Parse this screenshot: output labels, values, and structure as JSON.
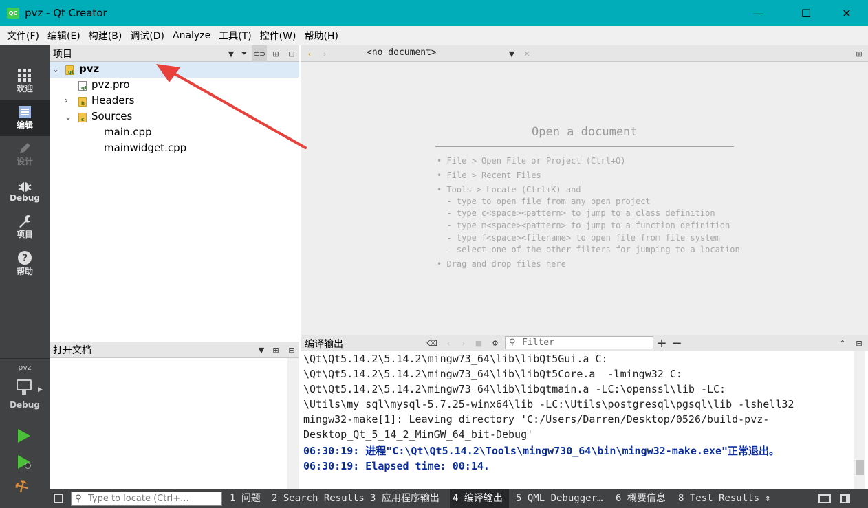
{
  "window": {
    "title": "pvz - Qt Creator",
    "logo": "QC",
    "minimize": "—",
    "maximize": "☐",
    "close": "✕"
  },
  "menu": [
    "文件(F)",
    "编辑(E)",
    "构建(B)",
    "调试(D)",
    "Analyze",
    "工具(T)",
    "控件(W)",
    "帮助(H)"
  ],
  "modes": [
    {
      "label": "欢迎",
      "icon": "grid-icon"
    },
    {
      "label": "编辑",
      "icon": "edit-document-icon"
    },
    {
      "label": "设计",
      "icon": "pencil-icon"
    },
    {
      "label": "Debug",
      "icon": "bug-icon"
    },
    {
      "label": "项目",
      "icon": "wrench-icon"
    },
    {
      "label": "帮助",
      "icon": "help-icon"
    }
  ],
  "kit": {
    "project": "pvz",
    "build": "Debug"
  },
  "project_panel": {
    "title": "项目",
    "tree": [
      {
        "label": "pvz",
        "level": 0,
        "expanded": true,
        "type": "project"
      },
      {
        "label": "pvz.pro",
        "level": 1,
        "type": "pro-file"
      },
      {
        "label": "Headers",
        "level": 1,
        "expanded": false,
        "type": "folder"
      },
      {
        "label": "Sources",
        "level": 1,
        "expanded": true,
        "type": "folder"
      },
      {
        "label": "main.cpp",
        "level": 2,
        "type": "cpp-file"
      },
      {
        "label": "mainwidget.cpp",
        "level": 2,
        "type": "cpp-file"
      }
    ]
  },
  "open_documents": {
    "title": "打开文档"
  },
  "editor": {
    "document_combo": "<no document>",
    "welcome_title": "Open a document",
    "lines": [
      "• File > Open File or Project (Ctrl+O)",
      "• File > Recent Files",
      "• Tools > Locate (Ctrl+K) and",
      "  - type to open file from any open project",
      "  - type c<space><pattern> to jump to a class definition",
      "  - type m<space><pattern> to jump to a function definition",
      "  - type f<space><filename> to open file from file system",
      "  - select one of the other filters for jumping to a location",
      "• Drag and drop files here"
    ]
  },
  "output": {
    "title": "编译输出",
    "filter_placeholder": "Filter",
    "plus": "+",
    "minus": "−",
    "lines": [
      {
        "text": "\\Qt\\Qt5.14.2\\5.14.2\\mingw73_64\\lib\\libQt5Gui.a C:",
        "style": "normal"
      },
      {
        "text": "\\Qt\\Qt5.14.2\\5.14.2\\mingw73_64\\lib\\libQt5Core.a  -lmingw32 C:",
        "style": "normal"
      },
      {
        "text": "\\Qt\\Qt5.14.2\\5.14.2\\mingw73_64\\lib\\libqtmain.a -LC:\\openssl\\lib -LC:",
        "style": "normal"
      },
      {
        "text": "\\Utils\\my_sql\\mysql-5.7.25-winx64\\lib -LC:\\Utils\\postgresql\\pgsql\\lib -lshell32",
        "style": "normal"
      },
      {
        "text": "mingw32-make[1]: Leaving directory 'C:/Users/Darren/Desktop/0526/build-pvz-",
        "style": "normal"
      },
      {
        "text": "Desktop_Qt_5_14_2_MinGW_64_bit-Debug'",
        "style": "normal"
      },
      {
        "text": "06:30:19: 进程\"C:\\Qt\\Qt5.14.2\\Tools\\mingw730_64\\bin\\mingw32-make.exe\"正常退出。",
        "style": "blue"
      },
      {
        "text": "06:30:19: Elapsed time: 00:14.",
        "style": "blue"
      }
    ]
  },
  "statusbar": {
    "locator_placeholder": "Type to locate (Ctrl+...",
    "tabs": [
      {
        "label": "1 问题",
        "active": false
      },
      {
        "label": "2 Search Results",
        "active": false
      },
      {
        "label": "3 应用程序输出",
        "active": false
      },
      {
        "label": "4 编译输出",
        "active": true
      },
      {
        "label": "5 QML Debugger…",
        "active": false
      },
      {
        "label": "6 概要信息",
        "active": false
      },
      {
        "label": "8 Test Results",
        "active": false
      }
    ]
  },
  "colors": {
    "titlebar": "#00adb8",
    "sidebar": "#404244",
    "annotation_arrow": "#e8413c"
  }
}
